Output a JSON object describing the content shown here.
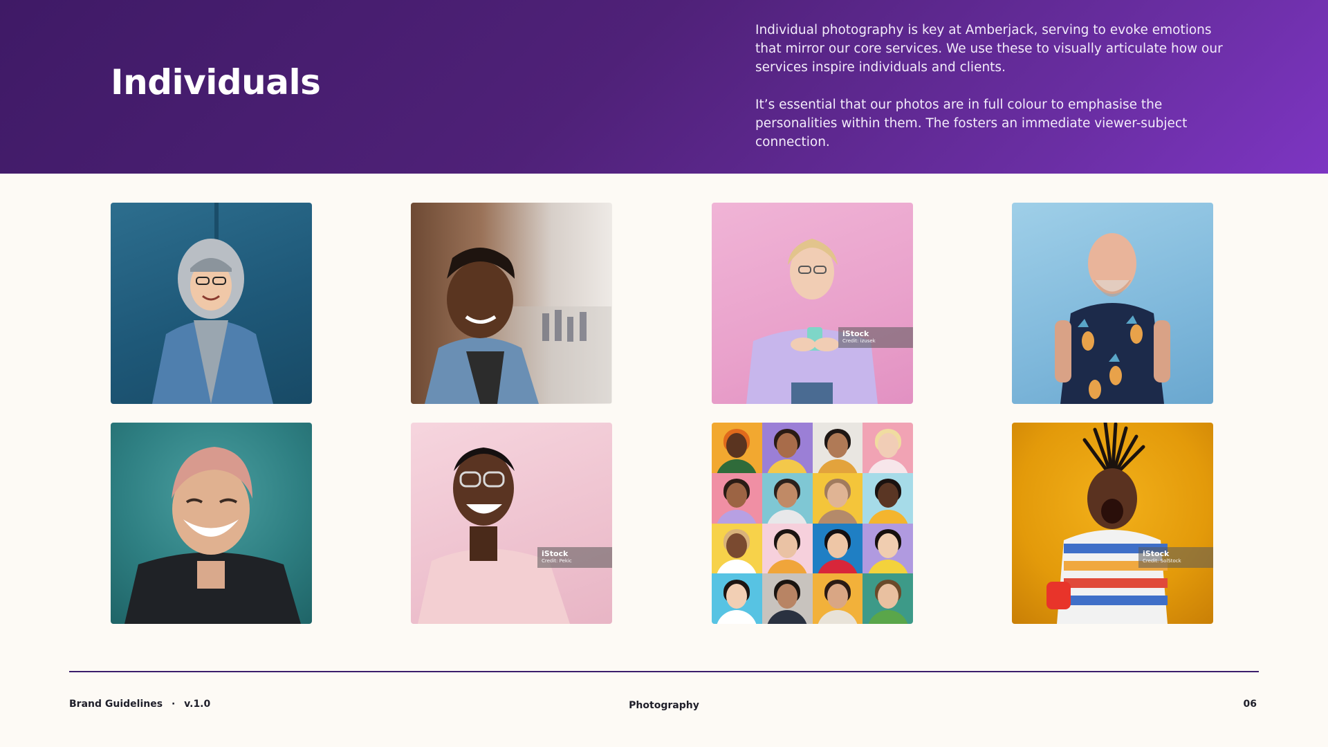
{
  "header": {
    "title": "Individuals",
    "paragraphs": [
      "Individual photography is key at Amberjack, serving to evoke emotions that mirror our core services. We use these to visually articulate how our services inspire individuals and clients.",
      "It’s essential that our photos are in full colour to emphasise the personalities within them. The fosters an immediate viewer-subject connection."
    ],
    "background_colors": [
      "#3f1a66",
      "#7d35c2"
    ]
  },
  "photos": [
    {
      "name": "portrait-hooded-woman",
      "watermark": null
    },
    {
      "name": "portrait-man-street",
      "watermark": null
    },
    {
      "name": "portrait-woman-phone",
      "watermark": {
        "brand": "iStock",
        "credit": "Credit: izusek"
      }
    },
    {
      "name": "portrait-bald-man",
      "watermark": null
    },
    {
      "name": "portrait-pink-hair",
      "watermark": null
    },
    {
      "name": "portrait-man-glasses",
      "watermark": {
        "brand": "iStock",
        "credit": "Credit: Pekic"
      }
    },
    {
      "name": "portrait-collage",
      "watermark": null
    },
    {
      "name": "portrait-hair-flip",
      "watermark": {
        "brand": "iStock",
        "credit": "Credit: SolStock"
      }
    }
  ],
  "footer": {
    "left_label": "Brand Guidelines",
    "separator": "·",
    "version": "v.1.0",
    "section": "Photography",
    "page_number": "06",
    "rule_color": "#3b1d6b"
  }
}
